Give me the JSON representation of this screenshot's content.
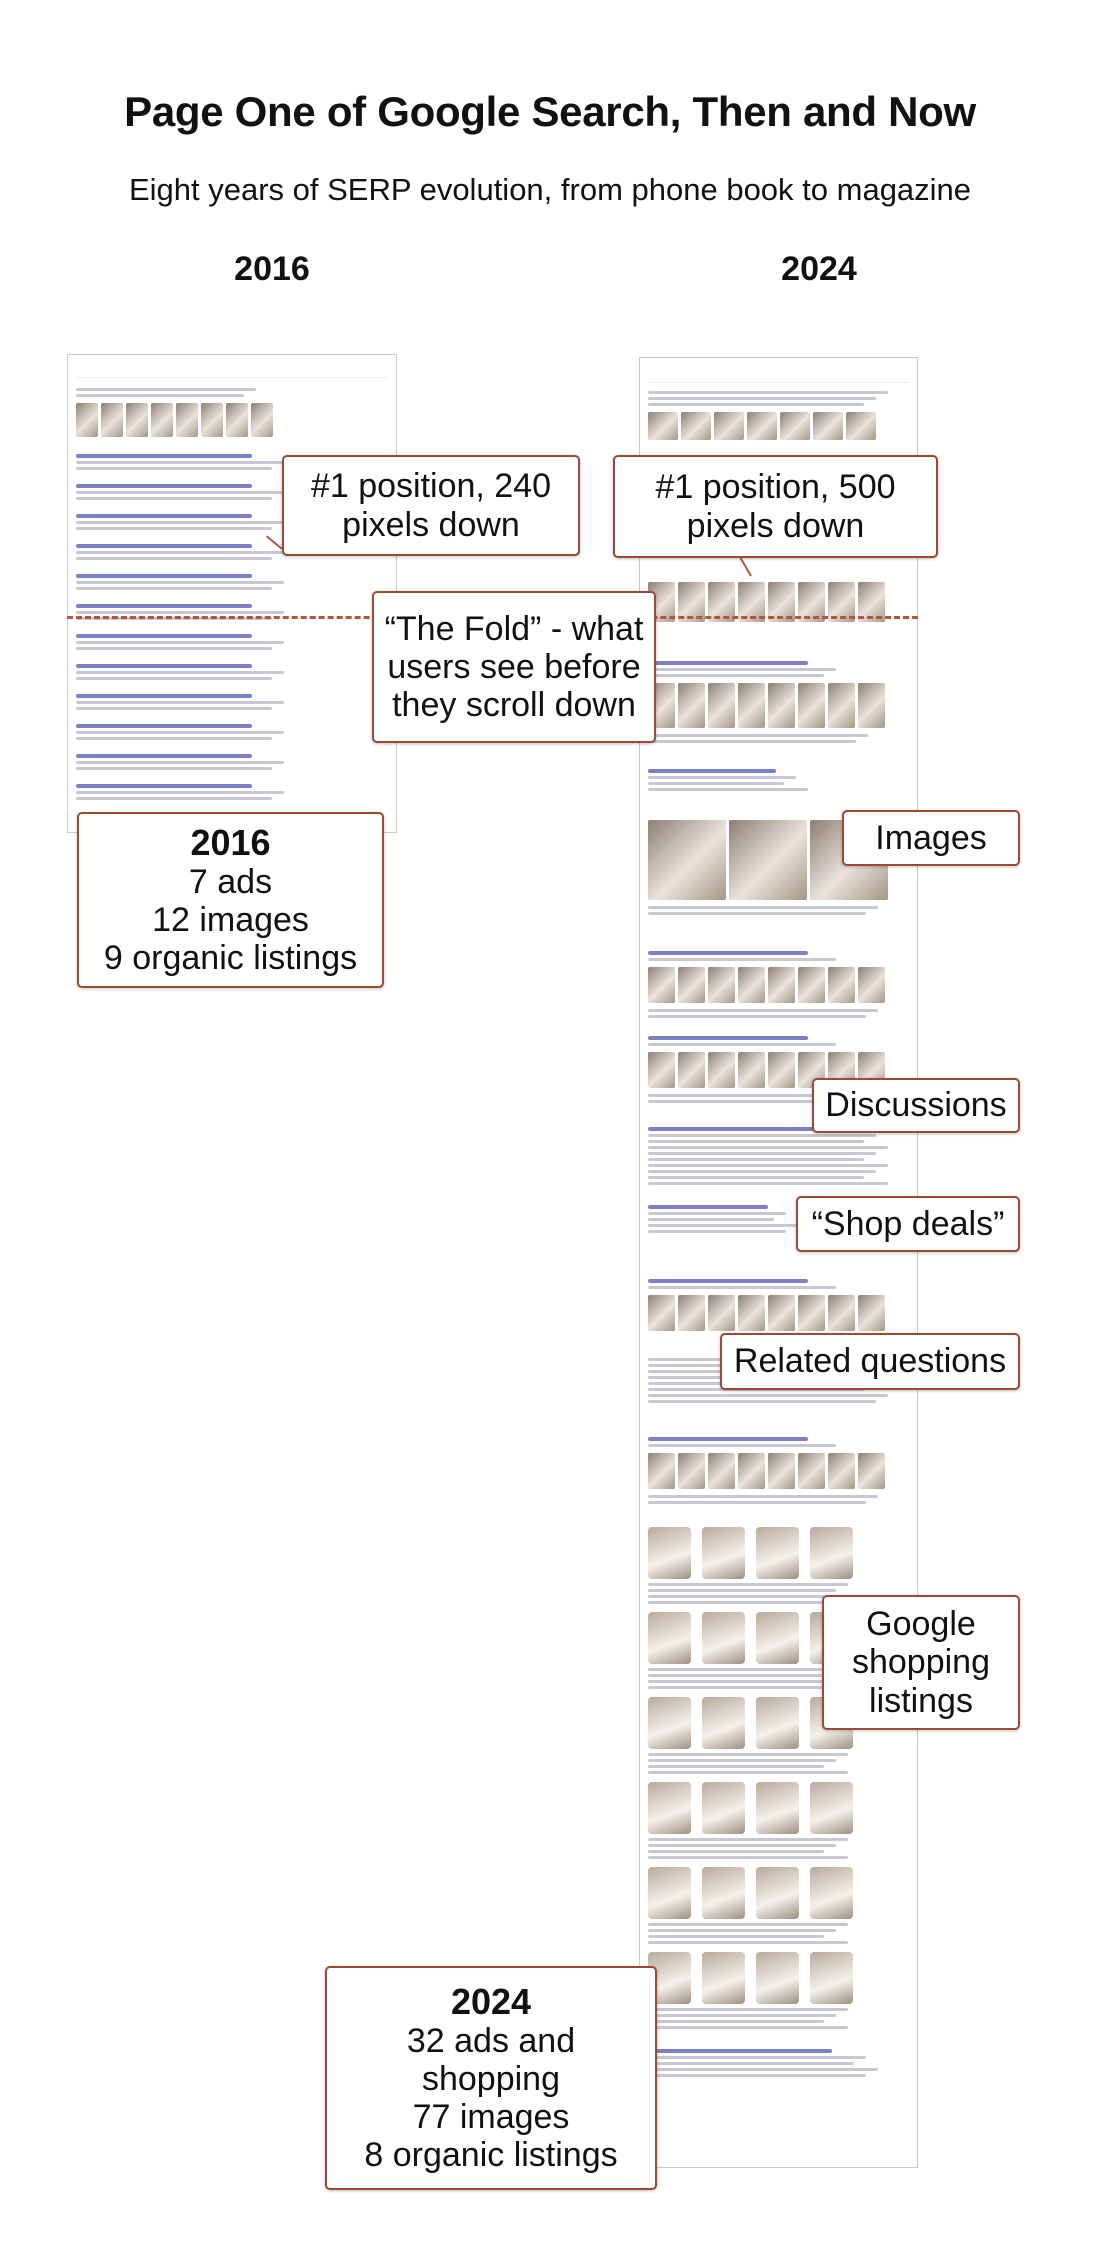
{
  "title": "Page One of Google Search, Then and Now",
  "subtitle": "Eight years of SERP evolution, from phone book to magazine",
  "columns": {
    "left_year": "2016",
    "right_year": "2024"
  },
  "callouts": {
    "left_position": "#1 position, 240 pixels down",
    "right_position": "#1 position, 500 pixels down",
    "fold": "“The Fold” - what users see before they scroll down",
    "images": "Images",
    "discussions": "Discussions",
    "shop_deals": "“Shop deals”",
    "related_questions": "Related questions",
    "shopping": "Google shopping listings"
  },
  "summary_2016": {
    "year": "2016",
    "lines": [
      "7 ads",
      "12 images",
      "9 organic listings"
    ]
  },
  "summary_2024": {
    "year": "2024",
    "lines": [
      "32 ads and shopping",
      "77 images",
      "8 organic listings"
    ]
  },
  "colors": {
    "accent": "#9c4a34",
    "fold_line": "#b5553a"
  }
}
